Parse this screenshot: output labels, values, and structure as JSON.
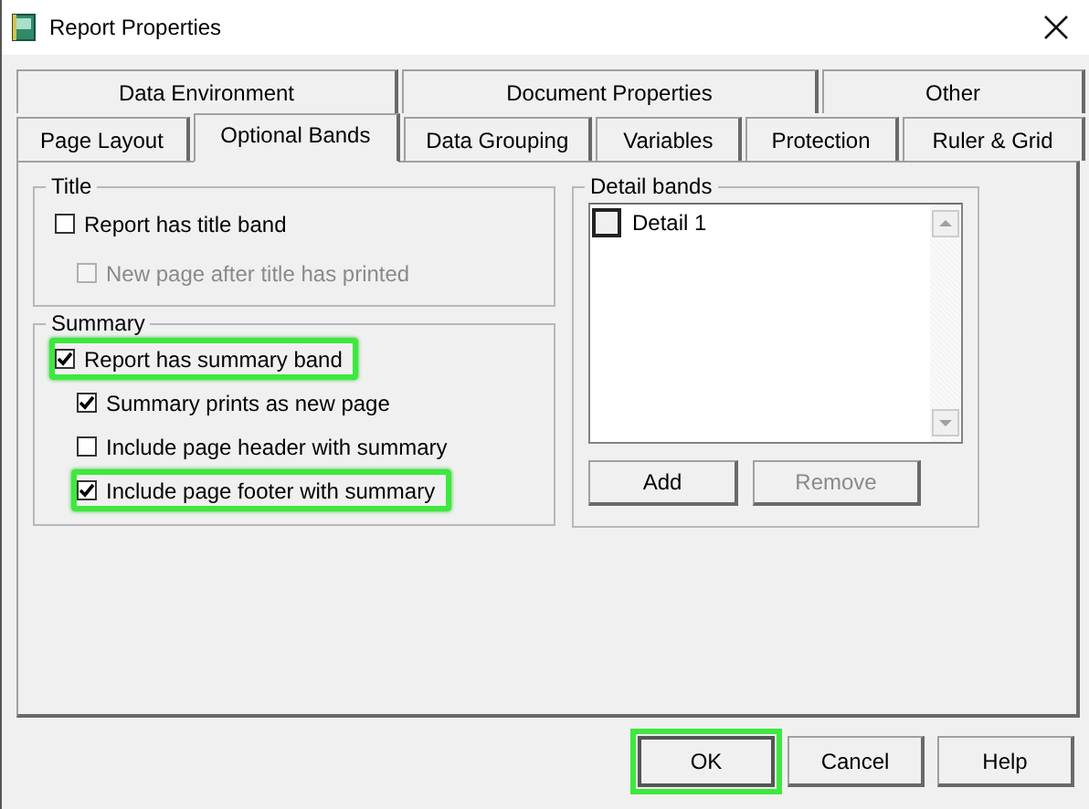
{
  "window": {
    "title": "Report Properties"
  },
  "tab_rows": [
    [
      {
        "label": "Data Environment",
        "selected": false
      },
      {
        "label": "Document Properties",
        "selected": false
      },
      {
        "label": "Other",
        "selected": false
      }
    ],
    [
      {
        "label": "Page Layout",
        "selected": false
      },
      {
        "label": "Optional Bands",
        "selected": true
      },
      {
        "label": "Data Grouping",
        "selected": false
      },
      {
        "label": "Variables",
        "selected": false
      },
      {
        "label": "Protection",
        "selected": false
      },
      {
        "label": "Ruler & Grid",
        "selected": false
      }
    ]
  ],
  "groups": [
    {
      "title": "Title",
      "options": [
        {
          "label": "Report has title band",
          "checked": false,
          "disabled": false,
          "highlighted": false,
          "children": [
            {
              "label": "New page after title has printed",
              "checked": false,
              "disabled": true,
              "highlighted": false
            }
          ]
        }
      ]
    },
    {
      "title": "Summary",
      "options": [
        {
          "label": "Report has summary band",
          "checked": true,
          "disabled": false,
          "highlighted": true,
          "children": [
            {
              "label": "Summary prints as new page",
              "checked": true,
              "disabled": false,
              "highlighted": false
            },
            {
              "label": "Include page header with summary",
              "checked": false,
              "disabled": false,
              "highlighted": false
            },
            {
              "label": "Include page footer with summary",
              "checked": true,
              "disabled": false,
              "highlighted": true
            }
          ]
        }
      ]
    }
  ],
  "detail_bands": {
    "title": "Detail bands",
    "items": [
      {
        "label": "Detail 1",
        "checked": false
      }
    ],
    "buttons": [
      {
        "label": "Add",
        "disabled": false
      },
      {
        "label": "Remove",
        "disabled": true
      }
    ]
  },
  "buttons": [
    {
      "label": "OK",
      "highlighted": true
    },
    {
      "label": "Cancel",
      "highlighted": false
    },
    {
      "label": "Help",
      "highlighted": false
    }
  ]
}
